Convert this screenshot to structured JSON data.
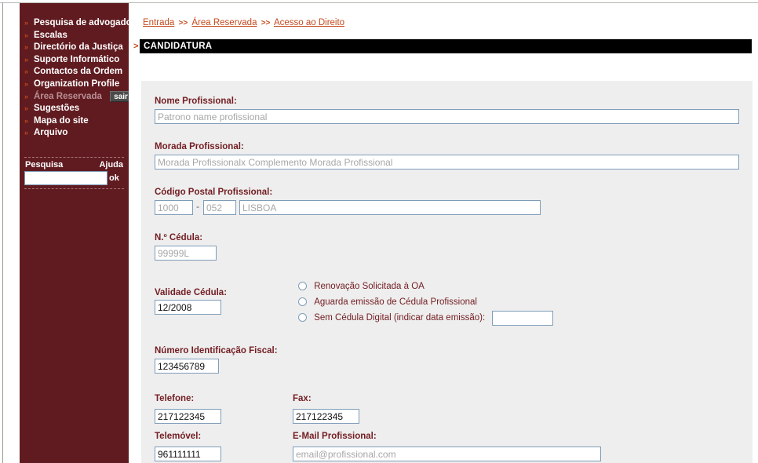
{
  "sidebar": {
    "items": [
      {
        "label": "Pesquisa de advogados",
        "dim": false,
        "has_sair": false
      },
      {
        "label": "Escalas",
        "dim": false,
        "has_sair": false
      },
      {
        "label": "Directório da Justiça",
        "dim": false,
        "has_sair": false
      },
      {
        "label": "Suporte Informático",
        "dim": false,
        "has_sair": false
      },
      {
        "label": "Contactos da Ordem",
        "dim": false,
        "has_sair": false
      },
      {
        "label": "Organization Profile",
        "dim": false,
        "has_sair": false
      },
      {
        "label": "Área Reservada",
        "dim": true,
        "has_sair": true
      },
      {
        "label": "Sugestões",
        "dim": false,
        "has_sair": false
      },
      {
        "label": "Mapa do site",
        "dim": false,
        "has_sair": false
      },
      {
        "label": "Arquivo",
        "dim": false,
        "has_sair": false
      }
    ],
    "logout_label": "sair",
    "search": {
      "label": "Pesquisa",
      "help_label": "Ajuda",
      "value": "",
      "placeholder": "",
      "submit_label": "ok"
    },
    "bullet_icon": "chevron-right-icon",
    "bg_color": "#601b20",
    "bullet_color": "#c1471a"
  },
  "breadcrumb": {
    "items": [
      "Entrada",
      "Área Reservada",
      "Acesso ao Direito"
    ],
    "separator": ">>"
  },
  "header": {
    "arrow": ">",
    "title": "CANDIDATURA",
    "bg_color": "#000000",
    "accent_color": "#c4491c"
  },
  "form": {
    "panel_bg": "#eeeeee",
    "label_color": "#731d22",
    "input_border": "#7f9db9",
    "fields": {
      "nome": {
        "label": "Nome Profissional:",
        "value": "",
        "placeholder": "Patrono name profissional"
      },
      "morada": {
        "label": "Morada Profissional:",
        "value": "",
        "placeholder": "Morada Profissionalx Complemento Morada Profissional"
      },
      "codigo_postal": {
        "label": "Código Postal Profissional:",
        "part1": {
          "value": "",
          "placeholder": "1000"
        },
        "separator": "-",
        "part2": {
          "value": "",
          "placeholder": "052"
        },
        "locality": {
          "value": "",
          "placeholder": "LISBOA"
        }
      },
      "cedula": {
        "label": "N.º Cédula:",
        "value": "",
        "placeholder": "99999L"
      },
      "validade_cedula": {
        "label": "Validade Cédula:",
        "value": "12/2008",
        "placeholder": ""
      },
      "nif": {
        "label": "Número Identificação Fiscal:",
        "value": "123456789",
        "placeholder": ""
      },
      "telefone": {
        "label": "Telefone:",
        "value": "217122345",
        "placeholder": ""
      },
      "fax": {
        "label": "Fax:",
        "value": "217122345",
        "placeholder": ""
      },
      "telemovel": {
        "label": "Telemóvel:",
        "value": "961111111",
        "placeholder": ""
      },
      "email": {
        "label": "E-Mail Profissional:",
        "value": "",
        "placeholder": "email@profissional.com"
      }
    },
    "cedula_options": [
      {
        "label": "Renovação Solicitada à OA",
        "selected": false,
        "has_date_input": false
      },
      {
        "label": "Aguarda emissão de Cédula Profissional",
        "selected": false,
        "has_date_input": false
      },
      {
        "label": "Sem Cédula Digital (indicar data emissão):",
        "selected": false,
        "has_date_input": true,
        "date_value": ""
      }
    ]
  }
}
